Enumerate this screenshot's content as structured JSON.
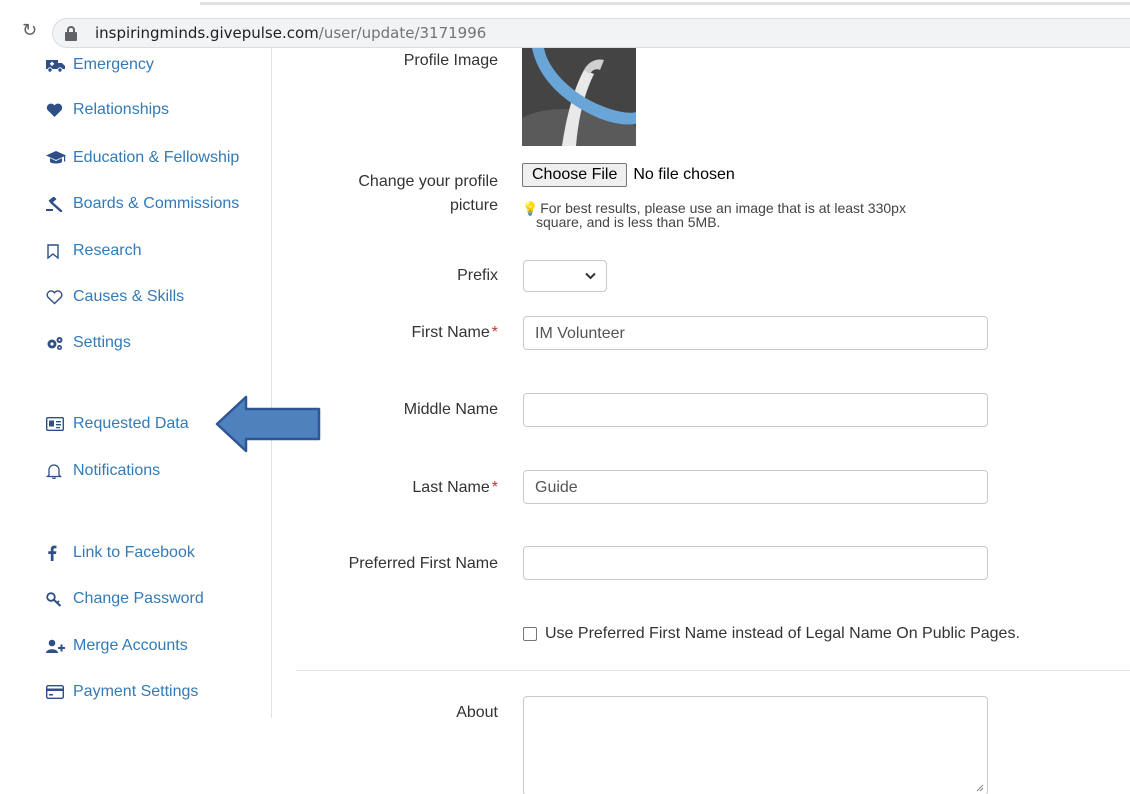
{
  "browser": {
    "url_host": "inspiringminds.givepulse.com",
    "url_path": "/user/update/3171996",
    "reload_icon": "reload-icon",
    "lock_icon": "lock-icon"
  },
  "sidebar": {
    "items": [
      {
        "label": "Emergency",
        "icon": "ambulance-icon"
      },
      {
        "label": "Relationships",
        "icon": "heart-icon"
      },
      {
        "label": "Education & Fellowship",
        "icon": "graduation-cap-icon"
      },
      {
        "label": "Boards & Commissions",
        "icon": "gavel-icon"
      },
      {
        "label": "Research",
        "icon": "bookmark-icon"
      },
      {
        "label": "Causes & Skills",
        "icon": "heart-outline-icon"
      },
      {
        "label": "Settings",
        "icon": "cogs-icon"
      },
      {
        "label": "Requested Data",
        "icon": "id-card-icon"
      },
      {
        "label": "Notifications",
        "icon": "bell-icon"
      },
      {
        "label": "Link to Facebook",
        "icon": "facebook-icon"
      },
      {
        "label": "Change Password",
        "icon": "key-icon"
      },
      {
        "label": "Merge Accounts",
        "icon": "user-plus-icon"
      },
      {
        "label": "Payment Settings",
        "icon": "credit-card-icon"
      }
    ],
    "annotation": {
      "icon": "blue-arrow-icon",
      "color": "#4f81bd",
      "border": "#2f5597"
    }
  },
  "form": {
    "profile_image_label": "Profile Image",
    "change_picture_label_1": "Change your profile",
    "change_picture_label_2": "picture",
    "choose_file_label": "Choose File",
    "no_file_text": "No file chosen",
    "hint_text_1": "For best results, please use an image that is at least 330px",
    "hint_text_2": "square, and is less than 5MB.",
    "prefix_label": "Prefix",
    "prefix_value": "",
    "first_name_label": "First Name",
    "first_name_value": "IM Volunteer",
    "middle_name_label": "Middle Name",
    "middle_name_value": "",
    "last_name_label": "Last Name",
    "last_name_value": "Guide",
    "preferred_first_name_label": "Preferred First Name",
    "preferred_first_name_value": "",
    "required_mark": "*",
    "use_preferred_label": "Use Preferred First Name instead of Legal Name On Public Pages.",
    "use_preferred_checked": false,
    "about_label": "About",
    "about_value": ""
  },
  "colors": {
    "link": "#337ab7",
    "icon": "#2f4f86",
    "required": "#c0392b",
    "hint_bulb": "#e8a317"
  }
}
